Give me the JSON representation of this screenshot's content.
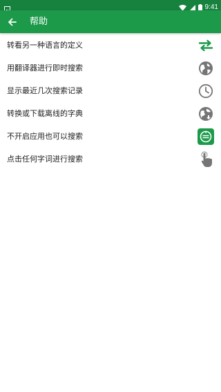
{
  "status_bar": {
    "time": "9:41"
  },
  "app_bar": {
    "title": "帮助"
  },
  "colors": {
    "primary": "#1c9a4a",
    "primary_dark": "#17823e",
    "icon_gray": "#757575"
  },
  "help_items": [
    {
      "label": "转看另一种语言的定义",
      "icon": "swap-arrows-icon"
    },
    {
      "label": "用翻译器进行即时搜索",
      "icon": "globe-icon"
    },
    {
      "label": "显示最近几次搜索记录",
      "icon": "clock-icon"
    },
    {
      "label": "转换或下载离线的字典",
      "icon": "globe-offline-icon"
    },
    {
      "label": "不开启应用也可以搜索",
      "icon": "quick-search-icon"
    },
    {
      "label": "点击任何字词进行搜索",
      "icon": "tap-finger-icon"
    }
  ]
}
